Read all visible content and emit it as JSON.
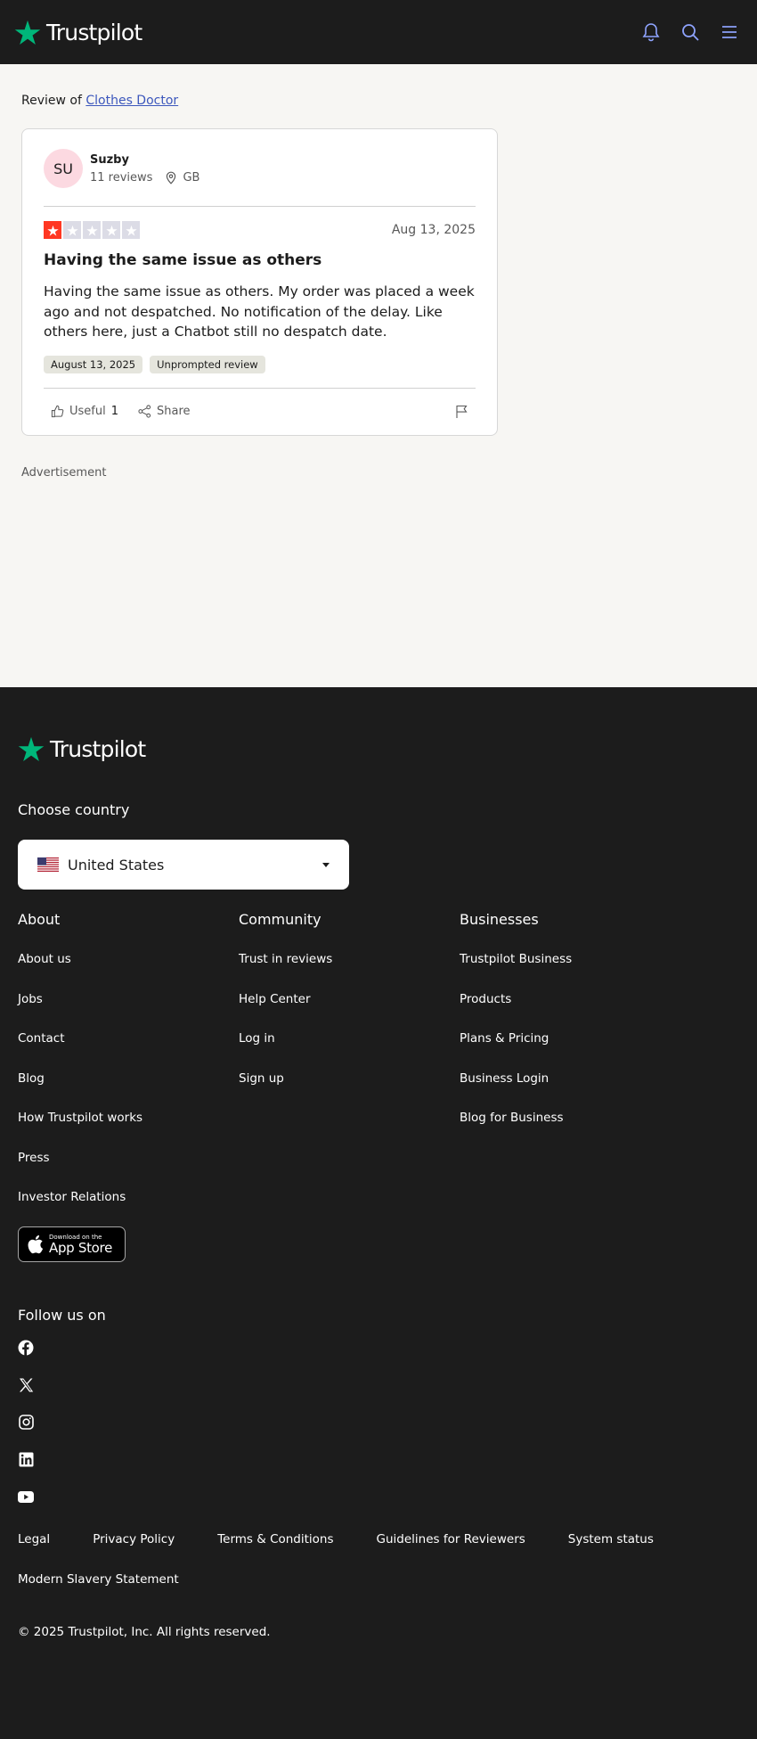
{
  "header": {
    "logo_text": "Trustpilot",
    "icons": [
      "bell-icon",
      "search-icon",
      "menu-icon"
    ],
    "accent": "#00b67a"
  },
  "review_page": {
    "review_of_prefix": "Review of",
    "business_name": "Clothes Doctor",
    "consumer": {
      "initials": "SU",
      "name": "Suzby",
      "reviews_count": "11 reviews",
      "country": "GB"
    },
    "rating": 1,
    "rating_max": 5,
    "star_color": "#ff3722",
    "date": "Aug 13, 2025",
    "title": "Having the same issue as others",
    "body": "Having the same issue as others. My order was placed a week ago and not despatched. No notification of the delay. Like others here, just a Chatbot still no despatch date.",
    "tags": [
      "August 13, 2025",
      "Unprompted review"
    ],
    "useful_label": "Useful",
    "useful_count": "1",
    "share_label": "Share",
    "advertisement_label": "Advertisement"
  },
  "footer": {
    "logo_text": "Trustpilot",
    "choose_country_label": "Choose country",
    "selected_country": "United States",
    "about": {
      "heading": "About",
      "links": [
        "About us",
        "Jobs",
        "Contact",
        "Blog",
        "How Trustpilot works",
        "Press",
        "Investor Relations"
      ]
    },
    "community": {
      "heading": "Community",
      "links": [
        "Trust in reviews",
        "Help Center",
        "Log in",
        "Sign up"
      ]
    },
    "businesses": {
      "heading": "Businesses",
      "links": [
        "Trustpilot Business",
        "Products",
        "Plans & Pricing",
        "Business Login",
        "Blog for Business"
      ]
    },
    "app_store": {
      "small": "Download on the",
      "big": "App Store"
    },
    "follow_label": "Follow us on",
    "social": [
      "facebook-icon",
      "x-icon",
      "instagram-icon",
      "linkedin-icon",
      "youtube-icon"
    ],
    "legal_links": [
      "Legal",
      "Privacy Policy",
      "Terms & Conditions",
      "Guidelines for Reviewers",
      "System status",
      "Modern Slavery Statement"
    ],
    "copyright": "© 2025 Trustpilot, Inc. All rights reserved."
  }
}
